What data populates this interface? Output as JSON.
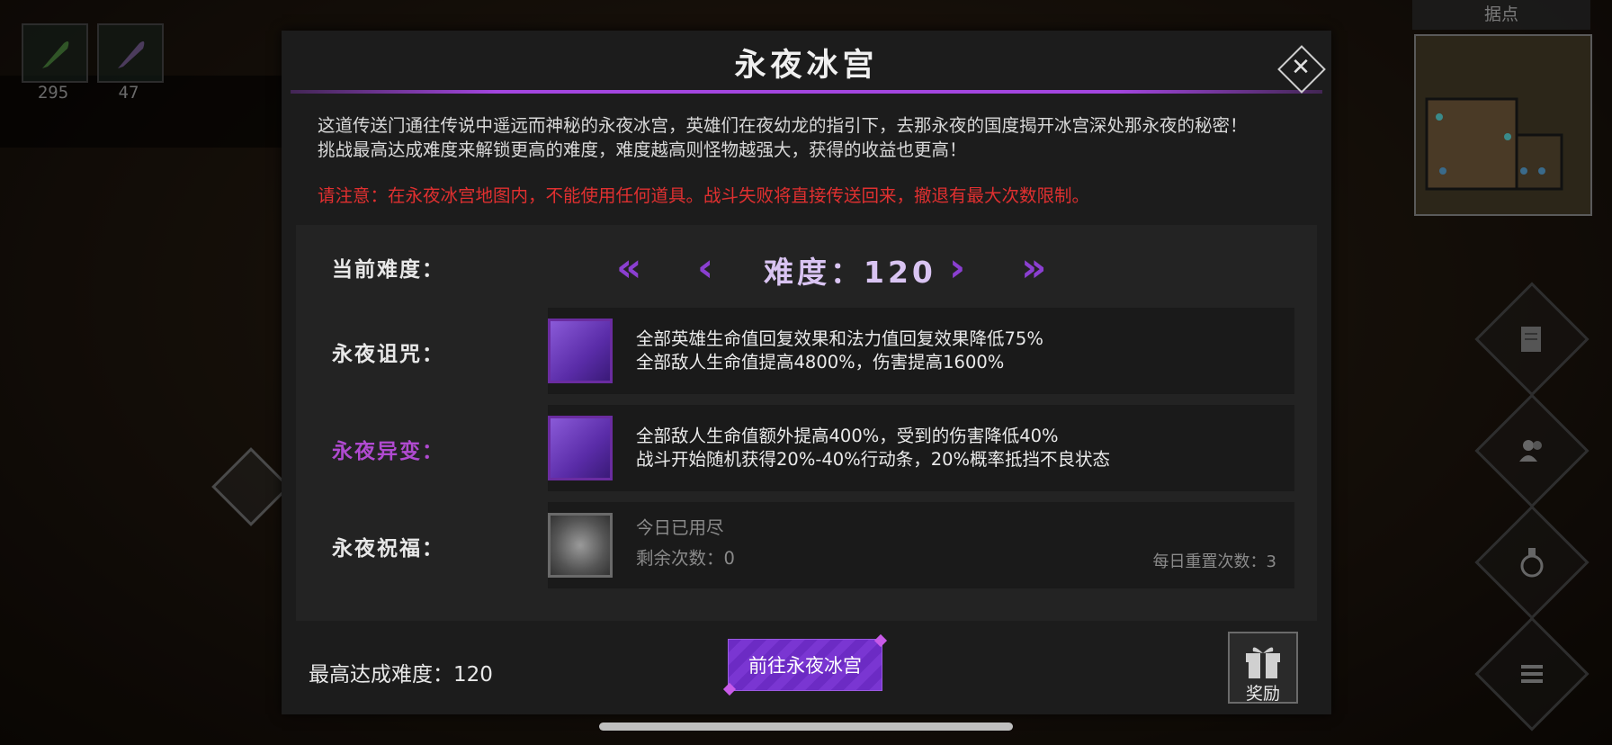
{
  "resources": [
    {
      "icon": "feather-green-icon",
      "value": "295"
    },
    {
      "icon": "feather-purple-icon",
      "value": "47"
    }
  ],
  "minimap": {
    "title": "据点"
  },
  "side_buttons": [
    "quest-scroll-icon",
    "heroes-icon",
    "potion-icon",
    "menu-list-icon"
  ],
  "dialog": {
    "title": "永夜冰宫",
    "description_line1": "这道传送门通往传说中遥远而神秘的永夜冰宫，英雄们在夜幼龙的指引下，去那永夜的国度揭开冰宫深处那永夜的秘密！",
    "description_line2": "挑战最高达成难度来解锁更高的难度，难度越高则怪物越强大，获得的收益也更高！",
    "warning": "请注意：在永夜冰宫地图内，不能使用任何道具。战斗失败将直接传送回来，撤退有最大次数限制。",
    "difficulty": {
      "label": "当前难度：",
      "value_text": "难度：120",
      "first_glyph": "«",
      "prev_glyph": "‹",
      "next_glyph": "›",
      "last_glyph": "»"
    },
    "curse": {
      "label": "永夜诅咒：",
      "line1": "全部英雄生命值回复效果和法力值回复效果降低75%",
      "line2": "全部敌人生命值提高4800%，伤害提高1600%"
    },
    "mutation": {
      "label": "永夜异变：",
      "line1": "全部敌人生命值额外提高400%，受到的伤害降低40%",
      "line2": "战斗开始随机获得20%-40%行动条，20%概率抵挡不良状态"
    },
    "blessing": {
      "label": "永夜祝福：",
      "status": "今日已用尽",
      "remaining": "剩余次数：0",
      "daily_reset": "每日重置次数：3"
    },
    "max_difficulty": "最高达成难度：120",
    "go_button": "前往永夜冰宫",
    "reward_label": "奖励",
    "close_glyph": "✕"
  },
  "colors": {
    "accent_purple": "#8b3fd1",
    "warning_red": "#e03030",
    "mutation_label": "#b04ad0"
  }
}
